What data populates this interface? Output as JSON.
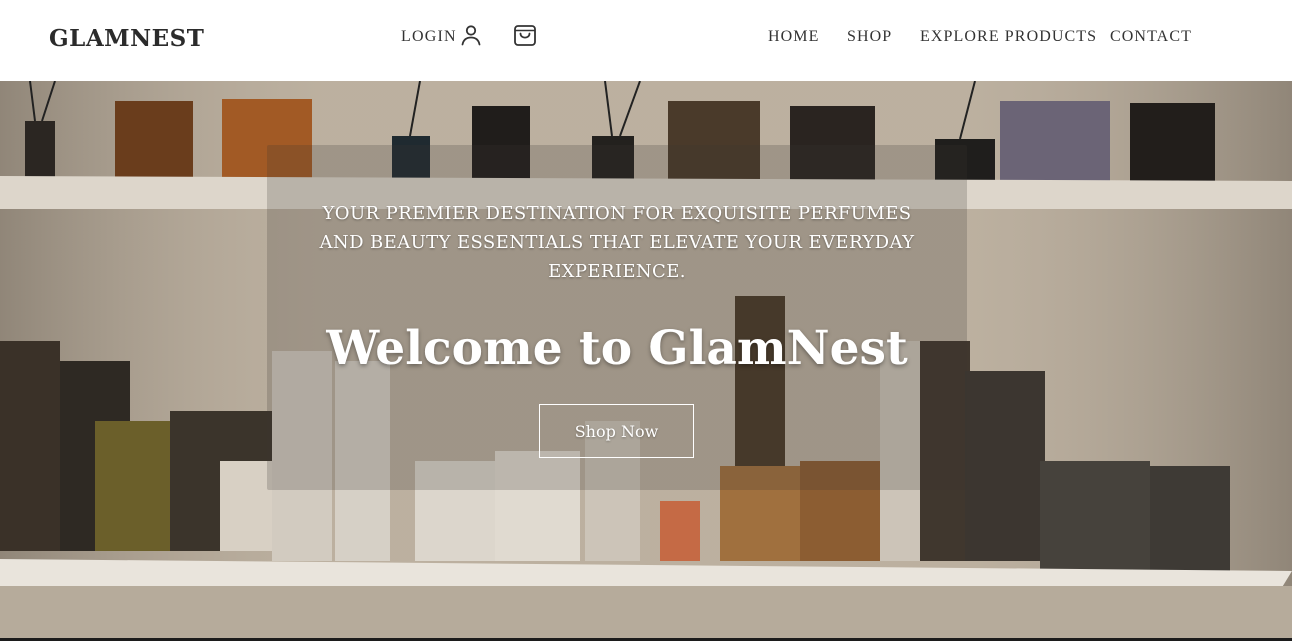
{
  "header": {
    "brand": "GLAMNEST",
    "login_label": "LOGIN",
    "user_icon": "user-icon",
    "cart_icon": "shopping-bag-icon",
    "nav": [
      {
        "label": "HOME"
      },
      {
        "label": "SHOP"
      },
      {
        "label": "EXPLORE PRODUCTS"
      },
      {
        "label": "CONTACT"
      }
    ]
  },
  "hero": {
    "tagline": "YOUR PREMIER DESTINATION FOR EXQUISITE PERFUMES AND BEAUTY ESSENTIALS THAT ELEVATE YOUR EVERYDAY EXPERIENCE.",
    "title": "Welcome to GlamNest",
    "cta_label": "Shop Now",
    "background": "perfume-shelves-photo"
  },
  "colors": {
    "header_bg": "#ffffff",
    "text_dark": "#333333",
    "hero_text": "#ffffff"
  }
}
